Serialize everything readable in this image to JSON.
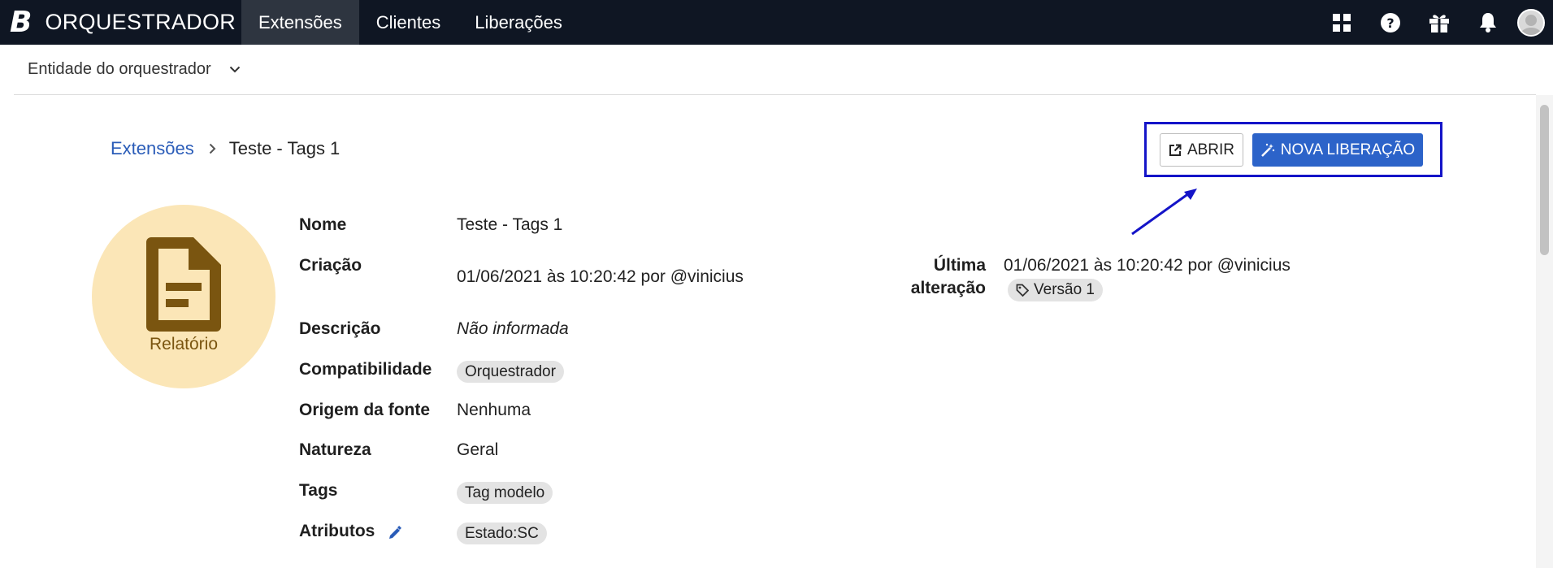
{
  "brand": {
    "logo": "B",
    "name": "ORQUESTRADOR"
  },
  "nav": {
    "items": [
      {
        "label": "Extensões",
        "active": true
      },
      {
        "label": "Clientes",
        "active": false
      },
      {
        "label": "Liberações",
        "active": false
      }
    ]
  },
  "top_icons": [
    "apps-grid-icon",
    "help-icon",
    "gift-icon",
    "bell-icon",
    "user-avatar"
  ],
  "entity": {
    "label": "Entidade do orquestrador"
  },
  "breadcrumb": {
    "parent": "Extensões",
    "current": "Teste - Tags 1"
  },
  "actions": {
    "open_label": "ABRIR",
    "new_release_label": "NOVA LIBERAÇÃO"
  },
  "type_badge": {
    "label": "Relatório"
  },
  "details": {
    "name_label": "Nome",
    "name_value": "Teste - Tags 1",
    "created_label": "Criação",
    "created_value": "01/06/2021 às 10:20:42 por @vinicius",
    "desc_label": "Descrição",
    "desc_value": "Não informada",
    "compat_label": "Compatibilidade",
    "compat_value": "Orquestrador",
    "source_label": "Origem da fonte",
    "source_value": "Nenhuma",
    "nature_label": "Natureza",
    "nature_value": "Geral",
    "tags_label": "Tags",
    "tags_value": "Tag modelo",
    "attrs_label": "Atributos",
    "attrs_value": "Estado:SC",
    "last_change_label_1": "Última",
    "last_change_label_2": "alteração",
    "last_change_value": "01/06/2021 às 10:20:42 por @vinicius",
    "version_value": "Versão 1"
  },
  "colors": {
    "topbar": "#0f1623",
    "primary": "#2c63c9",
    "highlight": "#1414c8",
    "badge_bg": "#fbe6b7",
    "badge_fg": "#7a5510"
  }
}
